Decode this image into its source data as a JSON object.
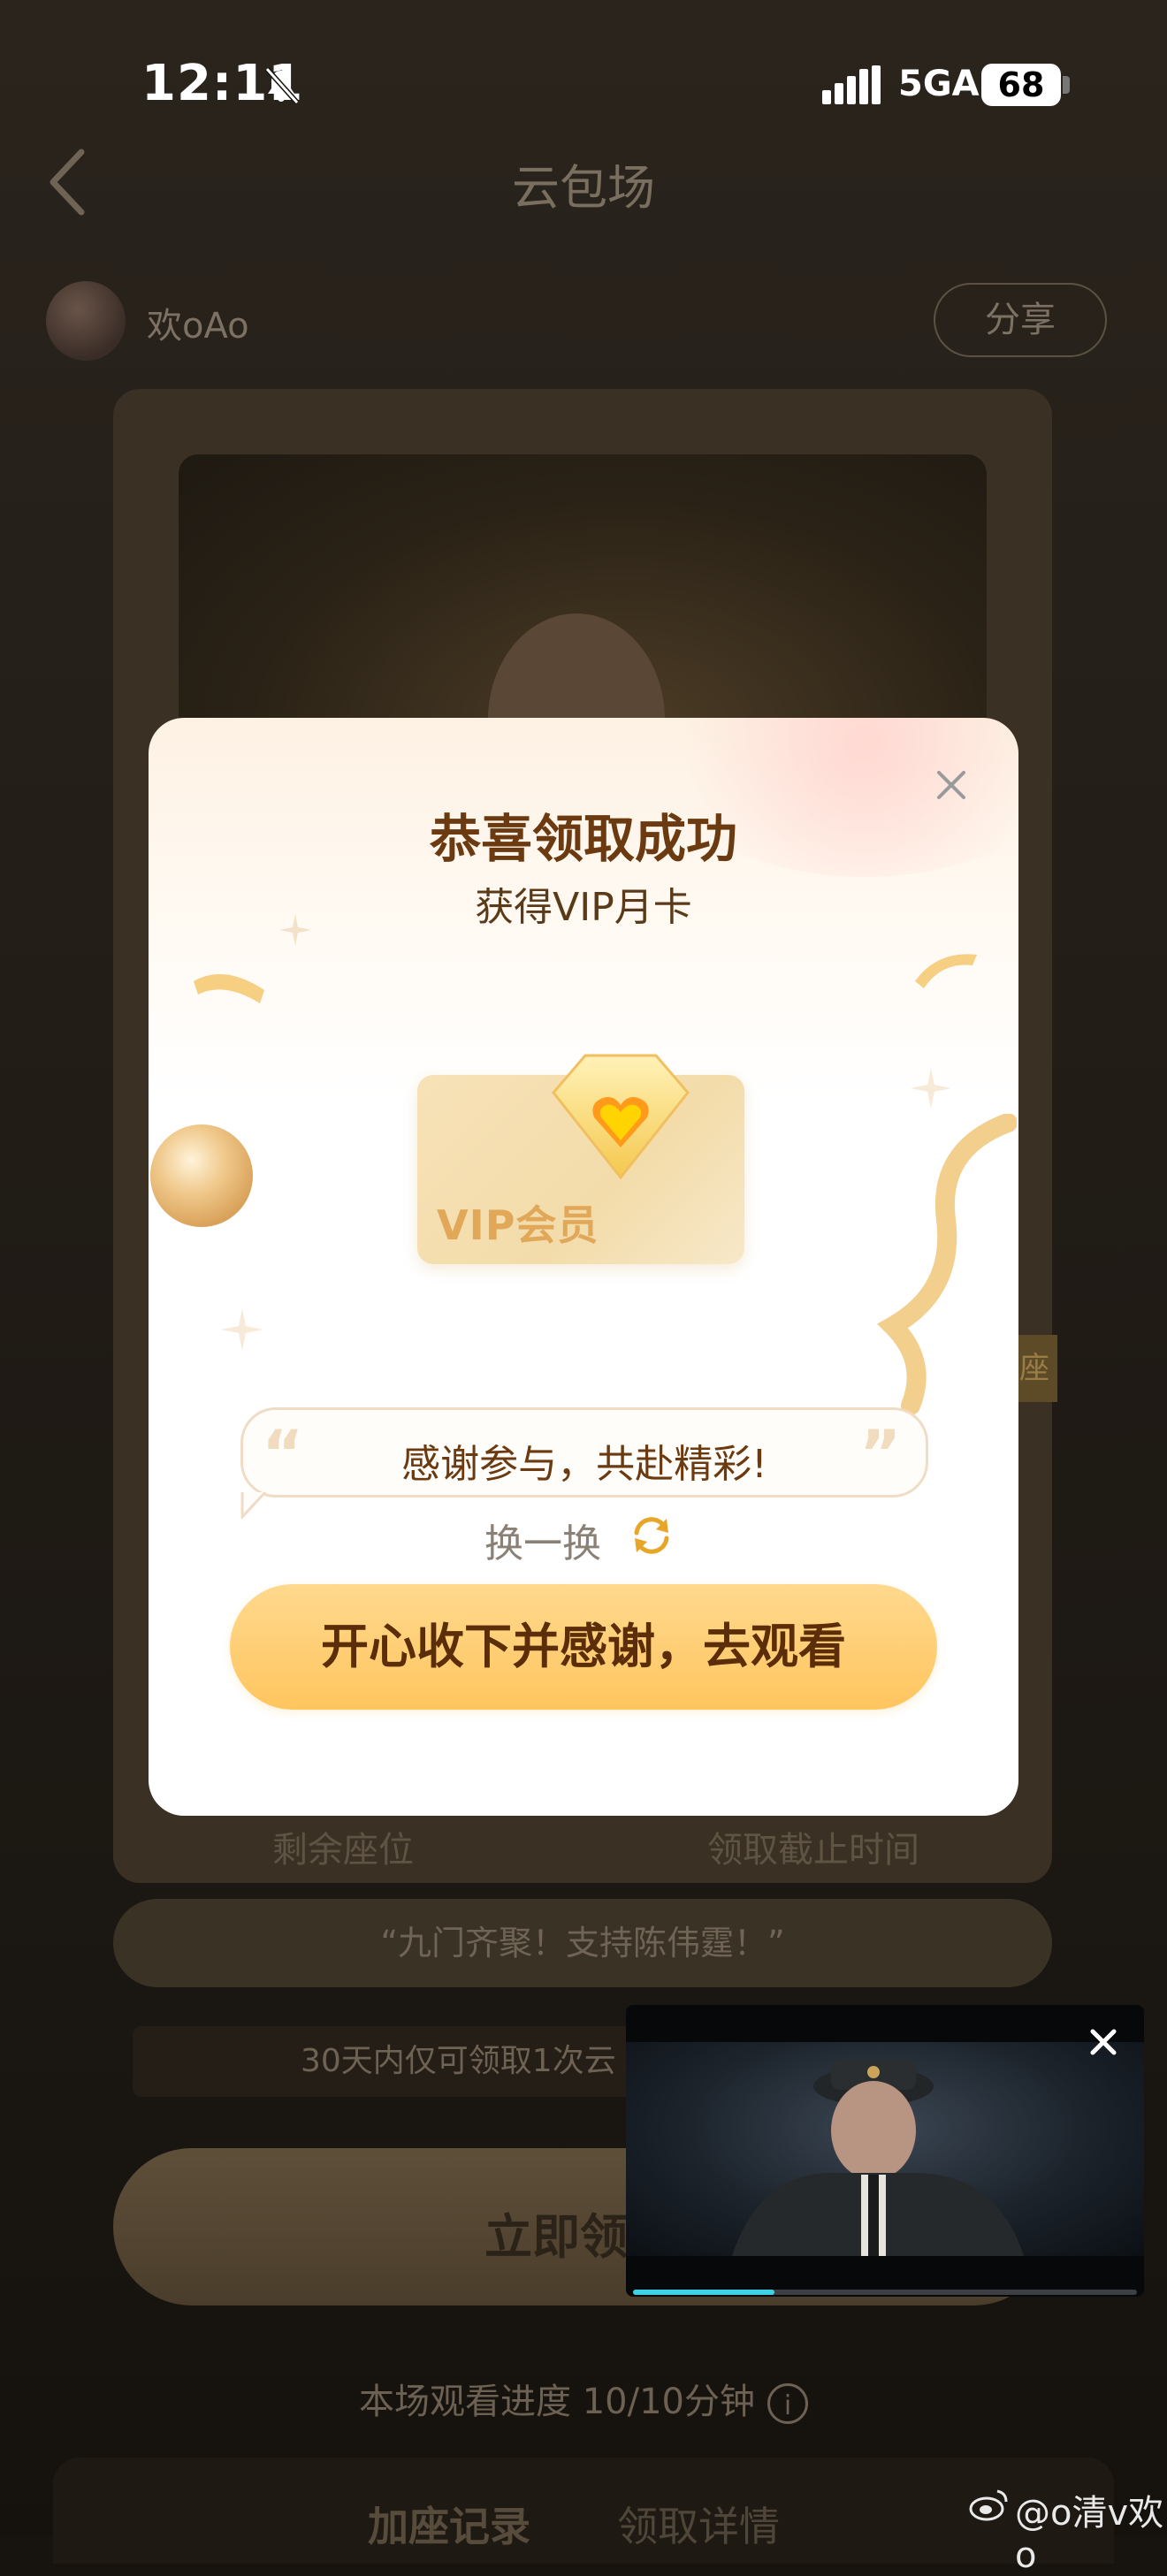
{
  "status_bar": {
    "time": "12:11",
    "network": "5GA",
    "battery": "68"
  },
  "header": {
    "title": "云包场"
  },
  "user": {
    "name": "欢oAo",
    "share_label": "分享"
  },
  "ticket": {
    "seat_tag": "座",
    "remaining_label": "剩余座位",
    "deadline_label": "领取截止时间",
    "slogan": "“九门齐聚！支持陈伟霆！”",
    "notice": "30天内仅可领取1次云",
    "claim_label": "立即领"
  },
  "progress": {
    "text": "本场观看进度 10/10分钟",
    "info_icon": "i"
  },
  "bottom_tabs": [
    "加座记录",
    "领取详情"
  ],
  "modal": {
    "title": "恭喜领取成功",
    "subtitle": "获得VIP月卡",
    "card_label": "VIP会员",
    "quote_open": "“",
    "quote_close": "”",
    "quote": "感谢参与，共赴精彩!",
    "swap_label": "换一换",
    "accept_label": "开心收下并感谢，去观看"
  },
  "video_player": {
    "progress": 0.28
  },
  "watermark": "@o清v欢o",
  "colors": {
    "accent_gold": "#ffc55f",
    "title_brown": "#6b3a10",
    "video_progress": "#3fd2e6"
  }
}
